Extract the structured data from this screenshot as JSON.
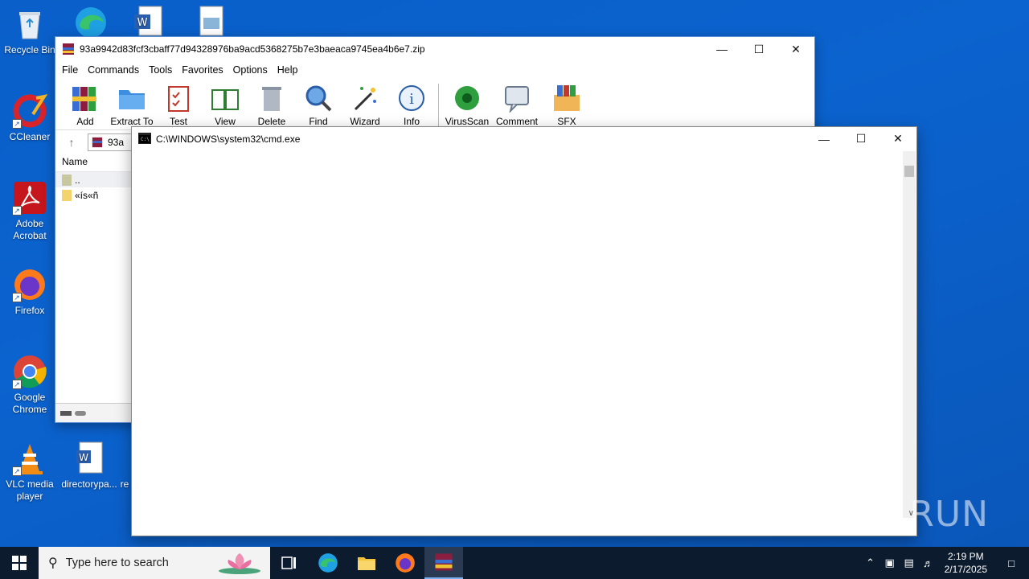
{
  "desktop": {
    "icons": [
      {
        "label": "Recycle Bin"
      },
      {
        "label": "CCleaner"
      },
      {
        "label": "Adobe Acrobat"
      },
      {
        "label": "Firefox"
      },
      {
        "label": "Google Chrome"
      },
      {
        "label": "VLC media player"
      },
      {
        "label": "directorypa..."
      },
      {
        "label": "re"
      }
    ]
  },
  "winrar": {
    "title": "93a9942d83fcf3cbaff77d94328976ba9acd5368275b7e3baeaca9745ea4b6e7.zip",
    "menu": [
      "File",
      "Commands",
      "Tools",
      "Favorites",
      "Options",
      "Help"
    ],
    "toolbar": [
      "Add",
      "Extract To",
      "Test",
      "View",
      "Delete",
      "Find",
      "Wizard",
      "Info",
      "VirusScan",
      "Comment",
      "SFX"
    ],
    "path_partial": "93a",
    "column_name": "Name",
    "files": [
      "..",
      "«ís«ñ"
    ]
  },
  "cmd": {
    "title": "C:\\WINDOWS\\system32\\cmd.exe"
  },
  "taskbar": {
    "search_placeholder": "Type here to search",
    "time": "2:19 PM",
    "date": "2/17/2025"
  },
  "watermark": "ANY RUN",
  "colors": {
    "desktop": "#0b63cf",
    "taskbar": "#0c1b2e"
  }
}
